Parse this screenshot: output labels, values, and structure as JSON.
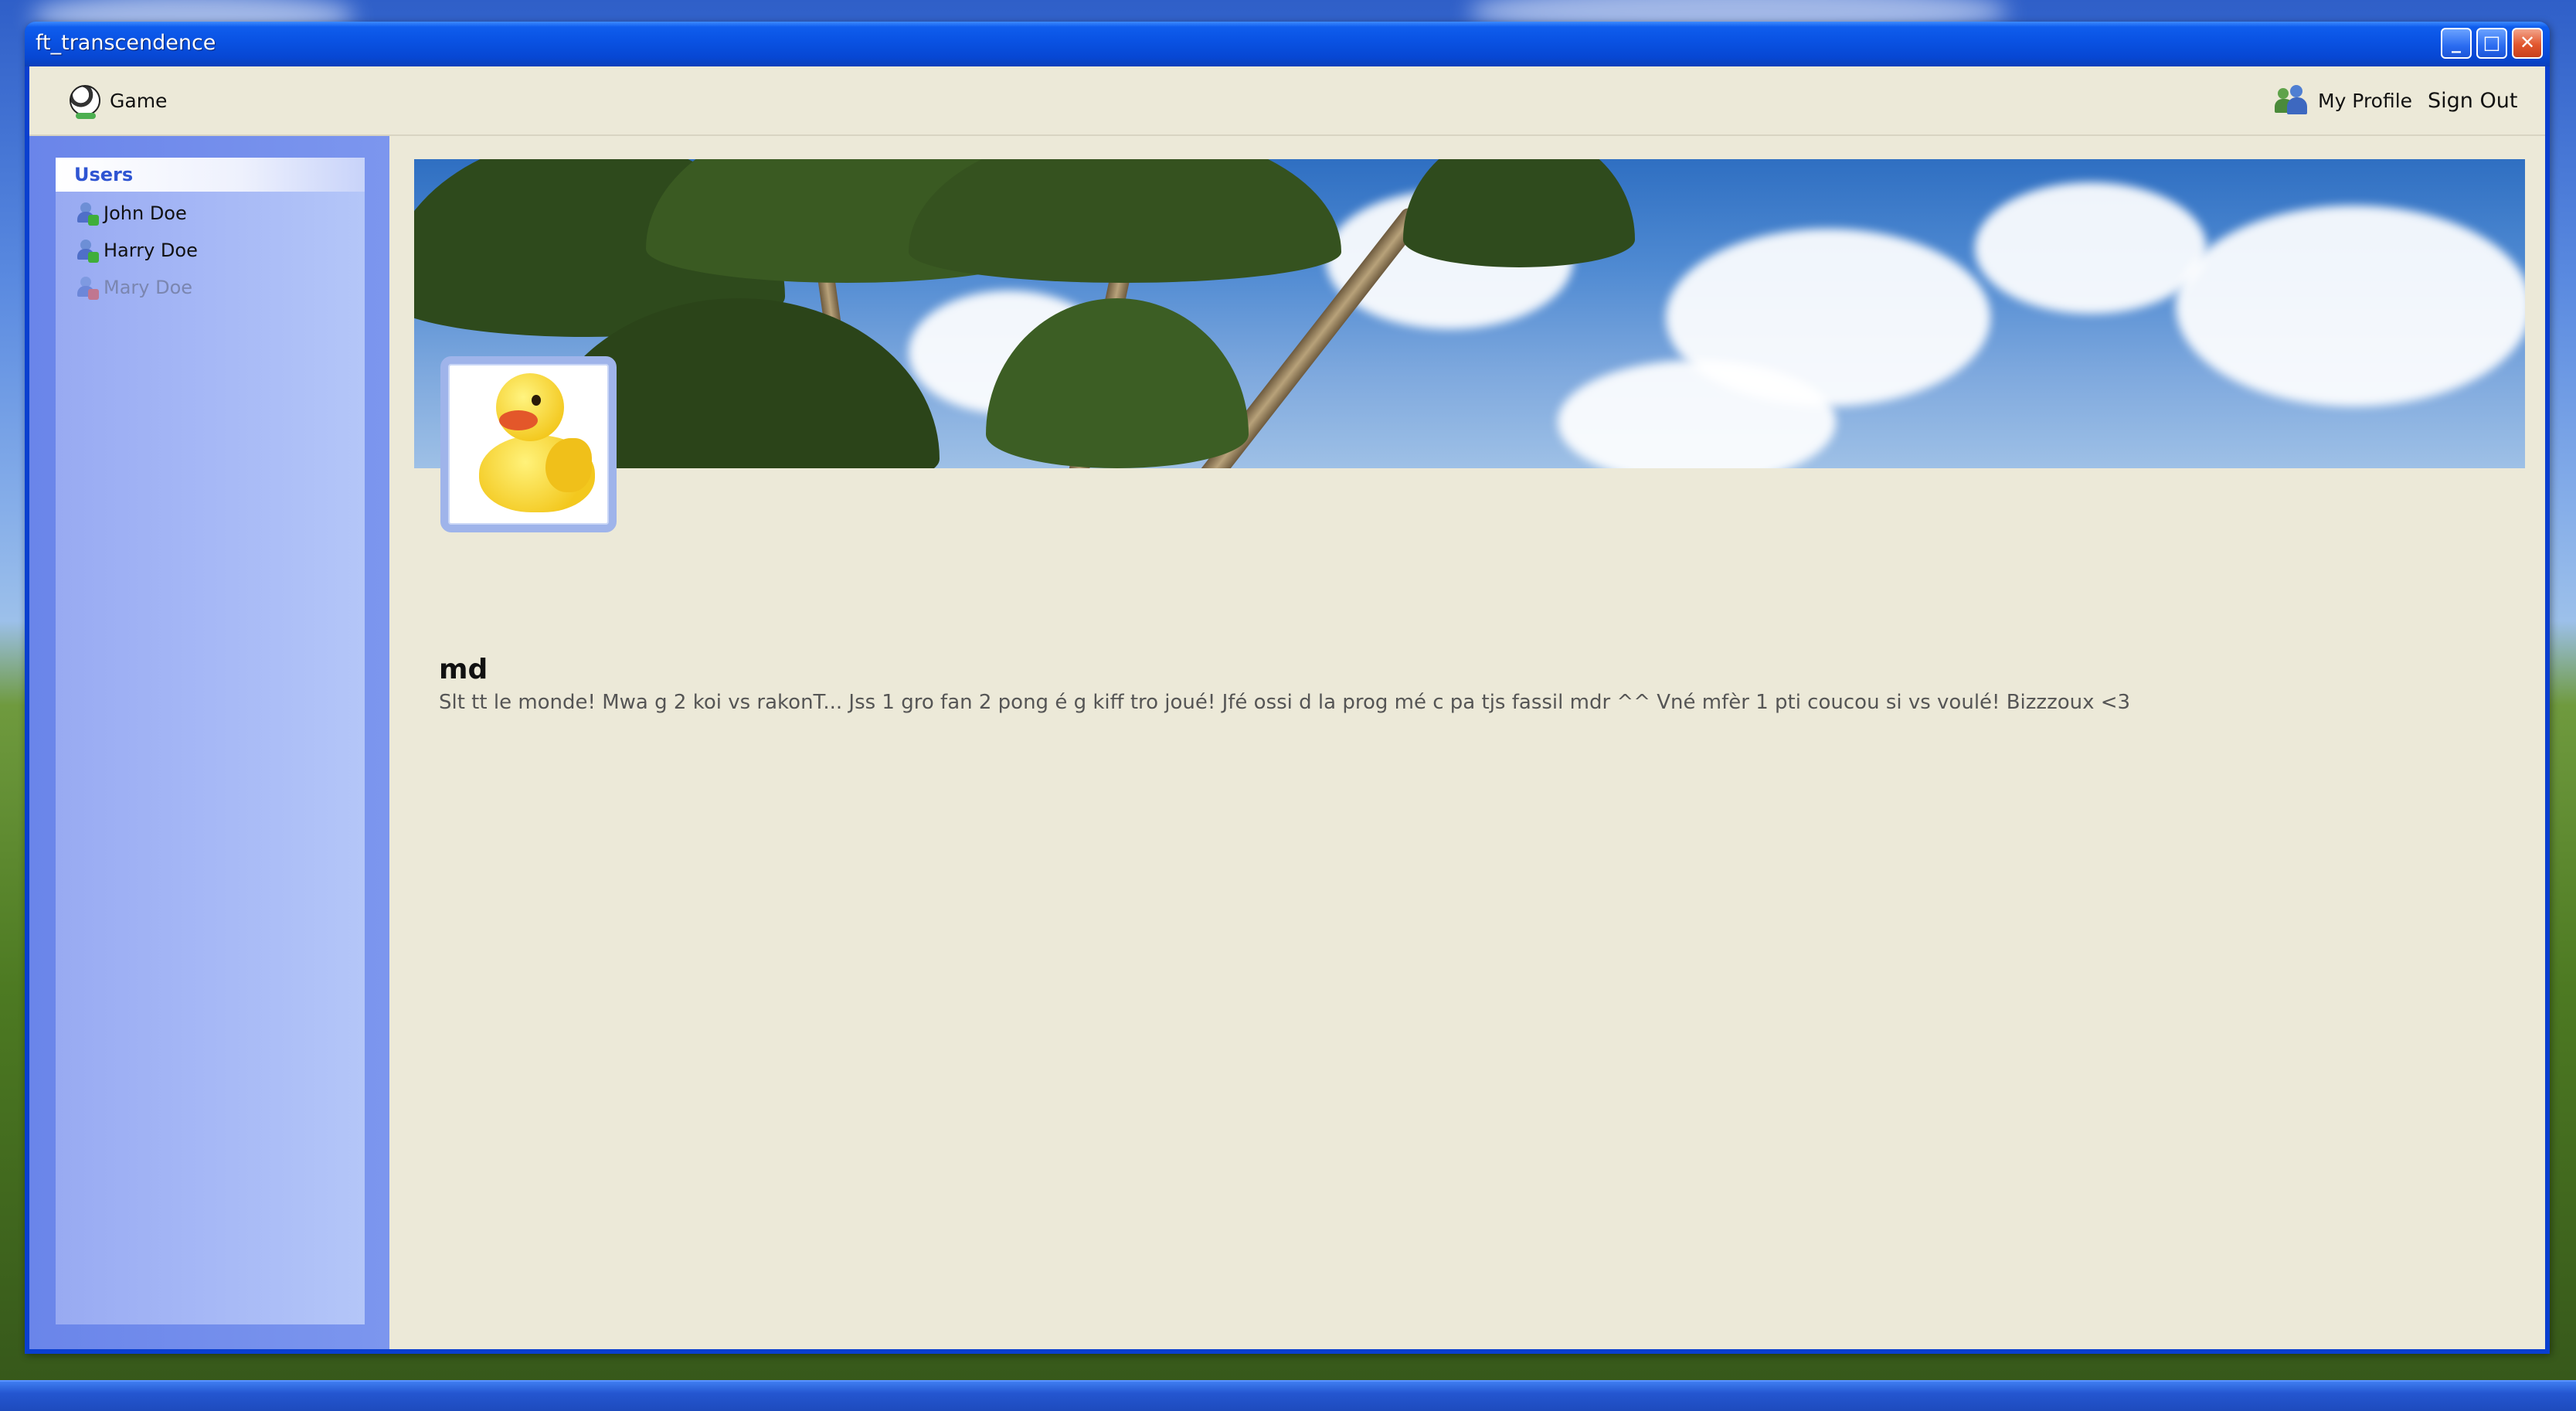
{
  "window": {
    "title": "ft_transcendence"
  },
  "nav": {
    "game_label": "Game",
    "profile_label": "My Profile",
    "signout_label": "Sign Out"
  },
  "sidebar": {
    "header": "Users",
    "users": [
      {
        "name": "John Doe",
        "status": "online"
      },
      {
        "name": "Harry Doe",
        "status": "online"
      },
      {
        "name": "Mary Doe",
        "status": "offline"
      }
    ]
  },
  "profile": {
    "username": "md",
    "bio": "Slt tt le monde! Mwa g 2 koi vs rakonT... Jss 1 gro fan 2 pong é g kiff tro joué! Jfé ossi d la prog mé c pa tjs fassil mdr ^^ Vné mfèr 1 pti coucou si vs voulé! Bizzzoux <3"
  },
  "colors": {
    "title_bar": "#0a53e4",
    "client_bg": "#ece9d8",
    "sidebar_bg": "#6a85ea",
    "users_header_text": "#2f55d2",
    "online_dot": "#3fae3a",
    "offline_dot": "#d9534f"
  }
}
